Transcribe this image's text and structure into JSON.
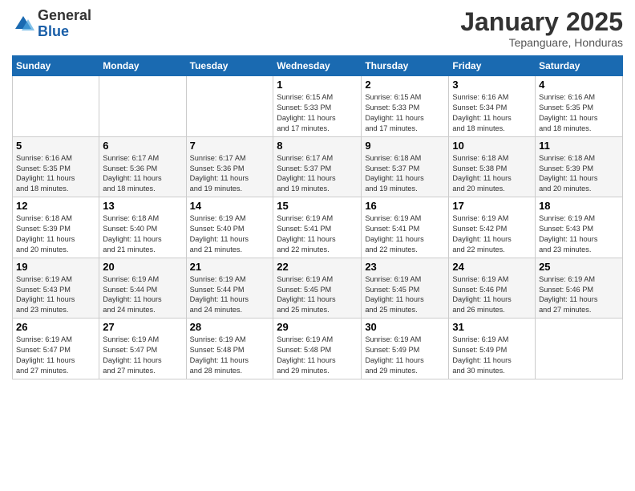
{
  "logo": {
    "general": "General",
    "blue": "Blue"
  },
  "header": {
    "month": "January 2025",
    "location": "Tepanguare, Honduras"
  },
  "weekdays": [
    "Sunday",
    "Monday",
    "Tuesday",
    "Wednesday",
    "Thursday",
    "Friday",
    "Saturday"
  ],
  "weeks": [
    [
      {
        "day": "",
        "info": ""
      },
      {
        "day": "",
        "info": ""
      },
      {
        "day": "",
        "info": ""
      },
      {
        "day": "1",
        "info": "Sunrise: 6:15 AM\nSunset: 5:33 PM\nDaylight: 11 hours\nand 17 minutes."
      },
      {
        "day": "2",
        "info": "Sunrise: 6:15 AM\nSunset: 5:33 PM\nDaylight: 11 hours\nand 17 minutes."
      },
      {
        "day": "3",
        "info": "Sunrise: 6:16 AM\nSunset: 5:34 PM\nDaylight: 11 hours\nand 18 minutes."
      },
      {
        "day": "4",
        "info": "Sunrise: 6:16 AM\nSunset: 5:35 PM\nDaylight: 11 hours\nand 18 minutes."
      }
    ],
    [
      {
        "day": "5",
        "info": "Sunrise: 6:16 AM\nSunset: 5:35 PM\nDaylight: 11 hours\nand 18 minutes."
      },
      {
        "day": "6",
        "info": "Sunrise: 6:17 AM\nSunset: 5:36 PM\nDaylight: 11 hours\nand 18 minutes."
      },
      {
        "day": "7",
        "info": "Sunrise: 6:17 AM\nSunset: 5:36 PM\nDaylight: 11 hours\nand 19 minutes."
      },
      {
        "day": "8",
        "info": "Sunrise: 6:17 AM\nSunset: 5:37 PM\nDaylight: 11 hours\nand 19 minutes."
      },
      {
        "day": "9",
        "info": "Sunrise: 6:18 AM\nSunset: 5:37 PM\nDaylight: 11 hours\nand 19 minutes."
      },
      {
        "day": "10",
        "info": "Sunrise: 6:18 AM\nSunset: 5:38 PM\nDaylight: 11 hours\nand 20 minutes."
      },
      {
        "day": "11",
        "info": "Sunrise: 6:18 AM\nSunset: 5:39 PM\nDaylight: 11 hours\nand 20 minutes."
      }
    ],
    [
      {
        "day": "12",
        "info": "Sunrise: 6:18 AM\nSunset: 5:39 PM\nDaylight: 11 hours\nand 20 minutes."
      },
      {
        "day": "13",
        "info": "Sunrise: 6:18 AM\nSunset: 5:40 PM\nDaylight: 11 hours\nand 21 minutes."
      },
      {
        "day": "14",
        "info": "Sunrise: 6:19 AM\nSunset: 5:40 PM\nDaylight: 11 hours\nand 21 minutes."
      },
      {
        "day": "15",
        "info": "Sunrise: 6:19 AM\nSunset: 5:41 PM\nDaylight: 11 hours\nand 22 minutes."
      },
      {
        "day": "16",
        "info": "Sunrise: 6:19 AM\nSunset: 5:41 PM\nDaylight: 11 hours\nand 22 minutes."
      },
      {
        "day": "17",
        "info": "Sunrise: 6:19 AM\nSunset: 5:42 PM\nDaylight: 11 hours\nand 22 minutes."
      },
      {
        "day": "18",
        "info": "Sunrise: 6:19 AM\nSunset: 5:43 PM\nDaylight: 11 hours\nand 23 minutes."
      }
    ],
    [
      {
        "day": "19",
        "info": "Sunrise: 6:19 AM\nSunset: 5:43 PM\nDaylight: 11 hours\nand 23 minutes."
      },
      {
        "day": "20",
        "info": "Sunrise: 6:19 AM\nSunset: 5:44 PM\nDaylight: 11 hours\nand 24 minutes."
      },
      {
        "day": "21",
        "info": "Sunrise: 6:19 AM\nSunset: 5:44 PM\nDaylight: 11 hours\nand 24 minutes."
      },
      {
        "day": "22",
        "info": "Sunrise: 6:19 AM\nSunset: 5:45 PM\nDaylight: 11 hours\nand 25 minutes."
      },
      {
        "day": "23",
        "info": "Sunrise: 6:19 AM\nSunset: 5:45 PM\nDaylight: 11 hours\nand 25 minutes."
      },
      {
        "day": "24",
        "info": "Sunrise: 6:19 AM\nSunset: 5:46 PM\nDaylight: 11 hours\nand 26 minutes."
      },
      {
        "day": "25",
        "info": "Sunrise: 6:19 AM\nSunset: 5:46 PM\nDaylight: 11 hours\nand 27 minutes."
      }
    ],
    [
      {
        "day": "26",
        "info": "Sunrise: 6:19 AM\nSunset: 5:47 PM\nDaylight: 11 hours\nand 27 minutes."
      },
      {
        "day": "27",
        "info": "Sunrise: 6:19 AM\nSunset: 5:47 PM\nDaylight: 11 hours\nand 27 minutes."
      },
      {
        "day": "28",
        "info": "Sunrise: 6:19 AM\nSunset: 5:48 PM\nDaylight: 11 hours\nand 28 minutes."
      },
      {
        "day": "29",
        "info": "Sunrise: 6:19 AM\nSunset: 5:48 PM\nDaylight: 11 hours\nand 29 minutes."
      },
      {
        "day": "30",
        "info": "Sunrise: 6:19 AM\nSunset: 5:49 PM\nDaylight: 11 hours\nand 29 minutes."
      },
      {
        "day": "31",
        "info": "Sunrise: 6:19 AM\nSunset: 5:49 PM\nDaylight: 11 hours\nand 30 minutes."
      },
      {
        "day": "",
        "info": ""
      }
    ]
  ]
}
